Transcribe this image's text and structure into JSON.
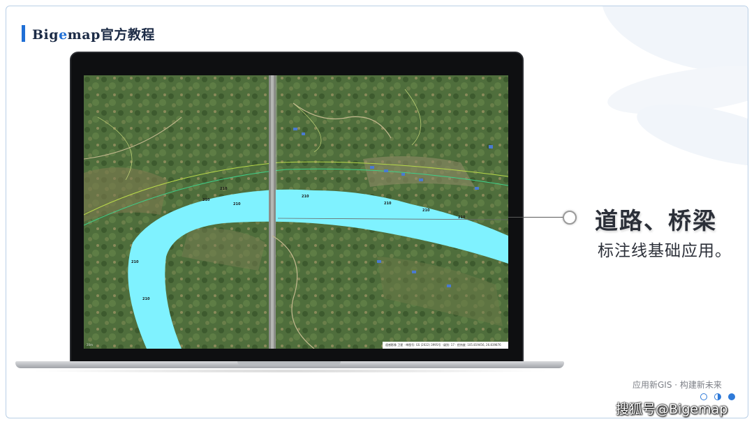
{
  "header": {
    "title_prefix": "Big",
    "title_accent": "e",
    "title_suffix": "map官方教程"
  },
  "callout": {
    "headline": "道路、桥梁",
    "subline": "标注线基础应用。"
  },
  "footer": {
    "slogan": "应用新GIS · 构建新未来",
    "dots": [
      "empty",
      "half",
      "full"
    ]
  },
  "watermark": "搜狐号@Bigemap",
  "map": {
    "status_text": "遥感影像 卫星 · 审图号: GS (2022) 3995号 · 级别: 17 · 经纬度: 105.819456, 26.839876",
    "scale_text": "20m",
    "contour_labels": [
      "210",
      "210",
      "210",
      "210",
      "210",
      "210",
      "210",
      "210",
      "210"
    ]
  },
  "colors": {
    "accent": "#1f6fd6",
    "river": "#7ff2ff",
    "frame_border": "#b9cfe6",
    "text_dark": "#2b2f38"
  }
}
